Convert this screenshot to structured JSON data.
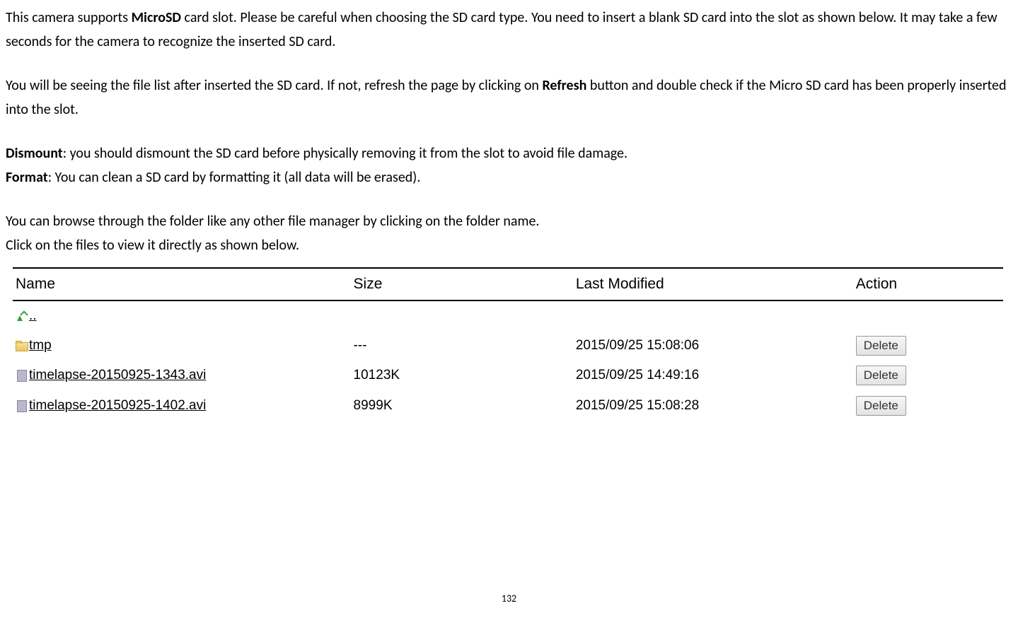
{
  "para1": {
    "t1": "This camera supports ",
    "b1": "MicroSD",
    "t2": " card slot. Please be careful when choosing the SD card type. You need to insert a blank SD card into the slot as shown below. It may take a few seconds for the camera to recognize the inserted SD card."
  },
  "para2": {
    "t1": "You will be seeing the file list after inserted the SD card. If not, refresh the page by clicking on ",
    "b1": "Refresh",
    "t2": " button and double check if the Micro SD card has been properly inserted into the slot."
  },
  "para3": {
    "b1": "Dismount",
    "t1": ": you should dismount the SD card before physically removing it from the slot to avoid file damage.",
    "b2": "Format",
    "t2": ": You can clean a SD card by formatting it (all data will be erased)."
  },
  "para4": {
    "t1": "You can browse through the folder like any other file manager by clicking on the folder name.",
    "t2": "Click on the files to view it directly as shown below."
  },
  "table": {
    "headers": {
      "name": "Name",
      "size": "Size",
      "modified": "Last Modified",
      "action": "Action"
    },
    "rows": [
      {
        "icon": "up",
        "name": "..",
        "size": "",
        "modified": "",
        "action": ""
      },
      {
        "icon": "folder",
        "name": "tmp",
        "size": "---",
        "modified": "2015/09/25 15:08:06",
        "action": "Delete"
      },
      {
        "icon": "file",
        "name": "timelapse-20150925-1343.avi",
        "size": "10123K",
        "modified": "2015/09/25 14:49:16",
        "action": "Delete"
      },
      {
        "icon": "file",
        "name": "timelapse-20150925-1402.avi",
        "size": "8999K",
        "modified": "2015/09/25 15:08:28",
        "action": "Delete"
      }
    ]
  },
  "pageNumber": "132"
}
